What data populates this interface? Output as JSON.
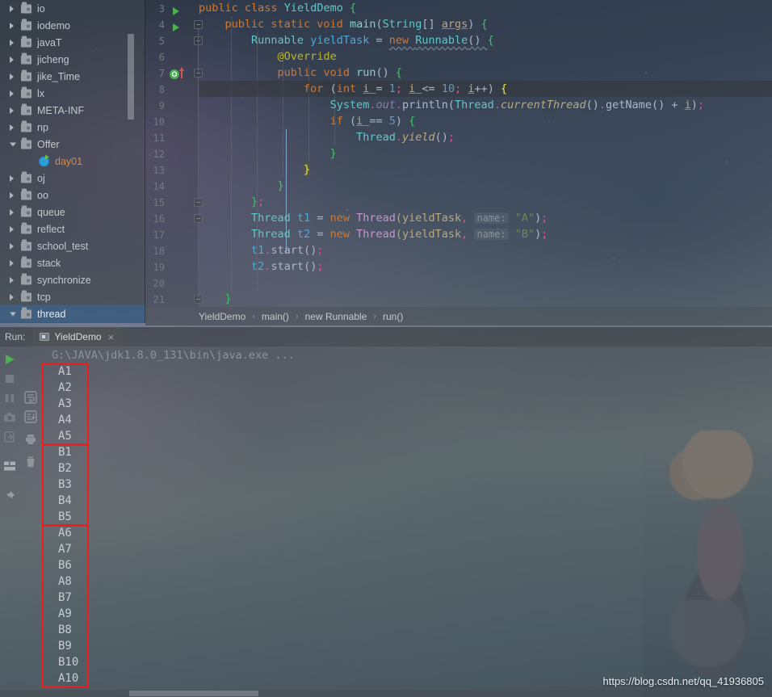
{
  "project_tree": {
    "items": [
      {
        "label": "io",
        "type": "folder",
        "expanded": false,
        "selected": false,
        "child": false
      },
      {
        "label": "iodemo",
        "type": "folder",
        "expanded": false,
        "selected": false,
        "child": false
      },
      {
        "label": "javaT",
        "type": "folder",
        "expanded": false,
        "selected": false,
        "child": false
      },
      {
        "label": "jicheng",
        "type": "folder",
        "expanded": false,
        "selected": false,
        "child": false
      },
      {
        "label": "jike_Time",
        "type": "folder",
        "expanded": false,
        "selected": false,
        "child": false
      },
      {
        "label": "lx",
        "type": "folder",
        "expanded": false,
        "selected": false,
        "child": false
      },
      {
        "label": "META-INF",
        "type": "folder",
        "expanded": false,
        "selected": false,
        "child": false
      },
      {
        "label": "np",
        "type": "folder",
        "expanded": false,
        "selected": false,
        "child": false
      },
      {
        "label": "Offer",
        "type": "folder",
        "expanded": true,
        "selected": false,
        "child": false
      },
      {
        "label": "day01",
        "type": "class",
        "expanded": false,
        "selected": false,
        "child": true
      },
      {
        "label": "oj",
        "type": "folder",
        "expanded": false,
        "selected": false,
        "child": false
      },
      {
        "label": "oo",
        "type": "folder",
        "expanded": false,
        "selected": false,
        "child": false
      },
      {
        "label": "queue",
        "type": "folder",
        "expanded": false,
        "selected": false,
        "child": false
      },
      {
        "label": "reflect",
        "type": "folder",
        "expanded": false,
        "selected": false,
        "child": false
      },
      {
        "label": "school_test",
        "type": "folder",
        "expanded": false,
        "selected": false,
        "child": false
      },
      {
        "label": "stack",
        "type": "folder",
        "expanded": false,
        "selected": false,
        "child": false
      },
      {
        "label": "synchronize",
        "type": "folder",
        "expanded": false,
        "selected": false,
        "child": false
      },
      {
        "label": "tcp",
        "type": "folder",
        "expanded": false,
        "selected": false,
        "child": false
      },
      {
        "label": "thread",
        "type": "folder",
        "expanded": true,
        "selected": true,
        "child": false
      }
    ]
  },
  "editor": {
    "file": "YieldDemo.java",
    "first_line_number": 3,
    "current_line": 8,
    "line_numbers": [
      3,
      4,
      5,
      6,
      7,
      8,
      9,
      10,
      11,
      12,
      13,
      14,
      15,
      16,
      17,
      18,
      19,
      20,
      21
    ],
    "code_lines": [
      "public class YieldDemo {",
      "    public static void main(String[] args) {",
      "        Runnable yieldTask = new Runnable() {",
      "            @Override",
      "            public void run() {",
      "                for (int i = 1; i <= 10; i++) {",
      "                    System.out.println(Thread.currentThread().getName() + i);",
      "                    if (i == 5) {",
      "                        Thread.yield();",
      "                    }",
      "                }",
      "            }",
      "        };",
      "        Thread t1 = new Thread(yieldTask, name: \"A\");",
      "        Thread t2 = new Thread(yieldTask, name: \"B\");",
      "        t1.start();",
      "        t2.start();",
      "",
      "    }"
    ],
    "param_hint_label": "name:",
    "gutter_markers": {
      "run_lines": [
        3,
        4
      ],
      "override_line": 7,
      "override_badge": "O"
    }
  },
  "breadcrumb": {
    "items": [
      "YieldDemo",
      "main()",
      "new Runnable",
      "run()"
    ],
    "separator": "›"
  },
  "run_panel": {
    "label": "Run:",
    "tab_title": "YieldDemo",
    "close_glyph": "×",
    "command_line": "G:\\JAVA\\jdk1.8.0_131\\bin\\java.exe ...",
    "output": [
      "A1",
      "A2",
      "A3",
      "A4",
      "A5",
      "B1",
      "B2",
      "B3",
      "B4",
      "B5",
      "A6",
      "A7",
      "B6",
      "A8",
      "B7",
      "A9",
      "B8",
      "B9",
      "B10",
      "A10"
    ],
    "toolbar_left_icons": [
      "run-icon",
      "stop-icon",
      "pause-icon",
      "camera-icon",
      "exit-icon",
      "layout-icon",
      "pin-icon"
    ],
    "toolbar_secondary_icons": [
      "soft-wrap-icon",
      "scroll-to-end-icon",
      "print-icon",
      "trash-icon"
    ],
    "annotations": [
      {
        "name": "box-thread-a-first-five",
        "start_index": 0,
        "count": 5
      },
      {
        "name": "box-thread-b-first-five",
        "start_index": 5,
        "count": 5
      },
      {
        "name": "box-interleaved-output",
        "start_index": 10,
        "count": 10
      }
    ],
    "annotation_color": "#f21b1b"
  },
  "watermark": {
    "text": "https://blog.csdn.net/qq_41936805"
  },
  "colors": {
    "keyword": "#cc7832",
    "class_name": "#5ec8c8",
    "string": "#6a8759",
    "number": "#6897bb",
    "field": "#9876aa",
    "annotation": "#bbb529",
    "punctuation": "#a9b7c6",
    "accent_red": "#f21b1b",
    "run_green": "#4caf50"
  }
}
